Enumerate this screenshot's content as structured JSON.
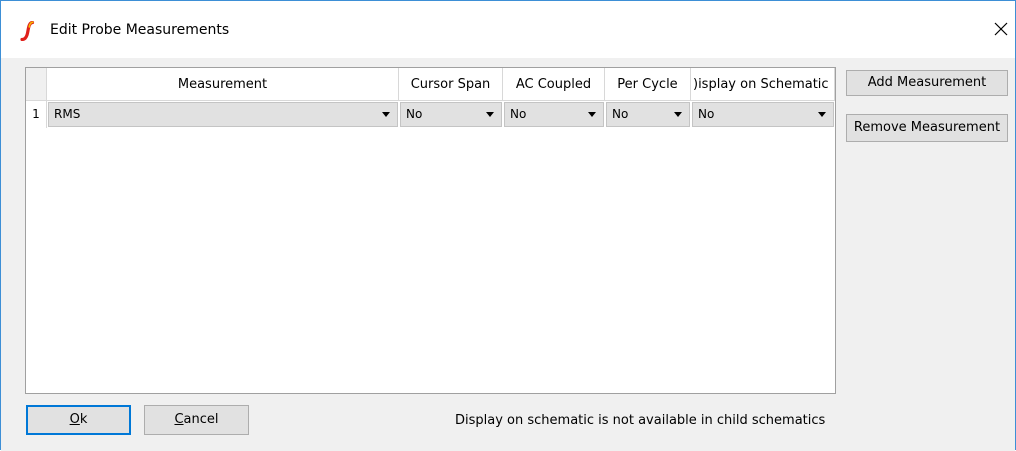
{
  "window": {
    "title": "Edit Probe Measurements",
    "app_icon": "ltspice-logo-icon",
    "close_icon": "close-icon"
  },
  "table": {
    "columns": [
      {
        "label": "Measurement"
      },
      {
        "label": "Cursor Span"
      },
      {
        "label": "AC Coupled"
      },
      {
        "label": "Per Cycle"
      },
      {
        "label": ")isplay on Schematic"
      }
    ],
    "rows": [
      {
        "row_number": "1",
        "measurement": "RMS",
        "cursor_span": "No",
        "ac_coupled": "No",
        "per_cycle": "No",
        "display_on_schematic": "No"
      }
    ]
  },
  "buttons": {
    "add_measurement": "Add Measurement",
    "remove_measurement": "Remove Measurement",
    "ok": "Ok",
    "cancel": "Cancel"
  },
  "status": {
    "message": "Display on schematic is not available in child schematics"
  },
  "colors": {
    "accent": "#0078d7",
    "window_border": "#3d8fd6",
    "dialog_bg": "#f0f0f0",
    "combo_bg": "#e1e1e1",
    "logo_red": "#e0201b",
    "logo_yellow": "#f5b800"
  }
}
